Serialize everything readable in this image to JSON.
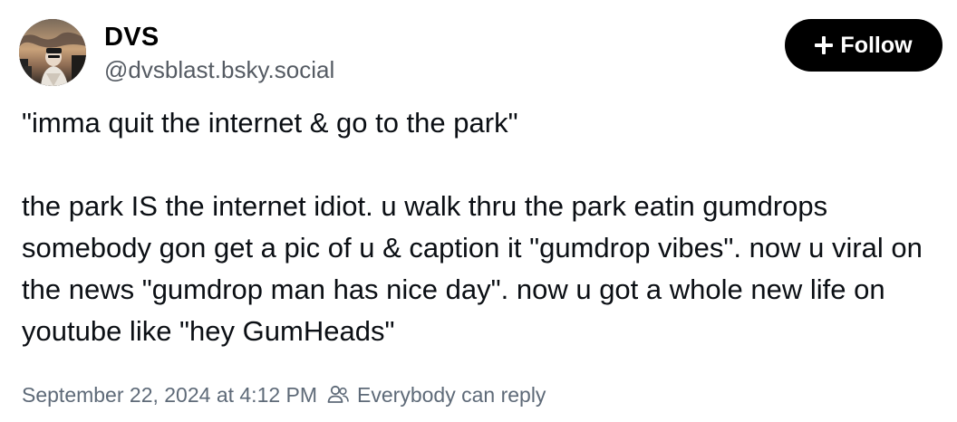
{
  "author": {
    "display_name": "DVS",
    "handle": "@dvsblast.bsky.social"
  },
  "actions": {
    "follow_label": "Follow"
  },
  "post": {
    "paragraphs": [
      "\"imma quit the internet & go to the park\"",
      "the park IS the internet idiot. u walk thru the park eatin gumdrops somebody gon get a pic of u & caption it \"gumdrop vibes\". now u viral on the news \"gumdrop man has nice day\". now u got a whole new life on youtube like \"hey GumHeads\""
    ]
  },
  "meta": {
    "timestamp": "September 22, 2024 at 4:12 PM",
    "reply_setting": "Everybody can reply"
  },
  "icons": {
    "follow": "plus-icon",
    "reply_setting": "people-icon"
  },
  "colors": {
    "button_background": "#000000",
    "button_text": "#ffffff",
    "handle_text": "#555b63",
    "meta_text": "#5e6a78"
  }
}
